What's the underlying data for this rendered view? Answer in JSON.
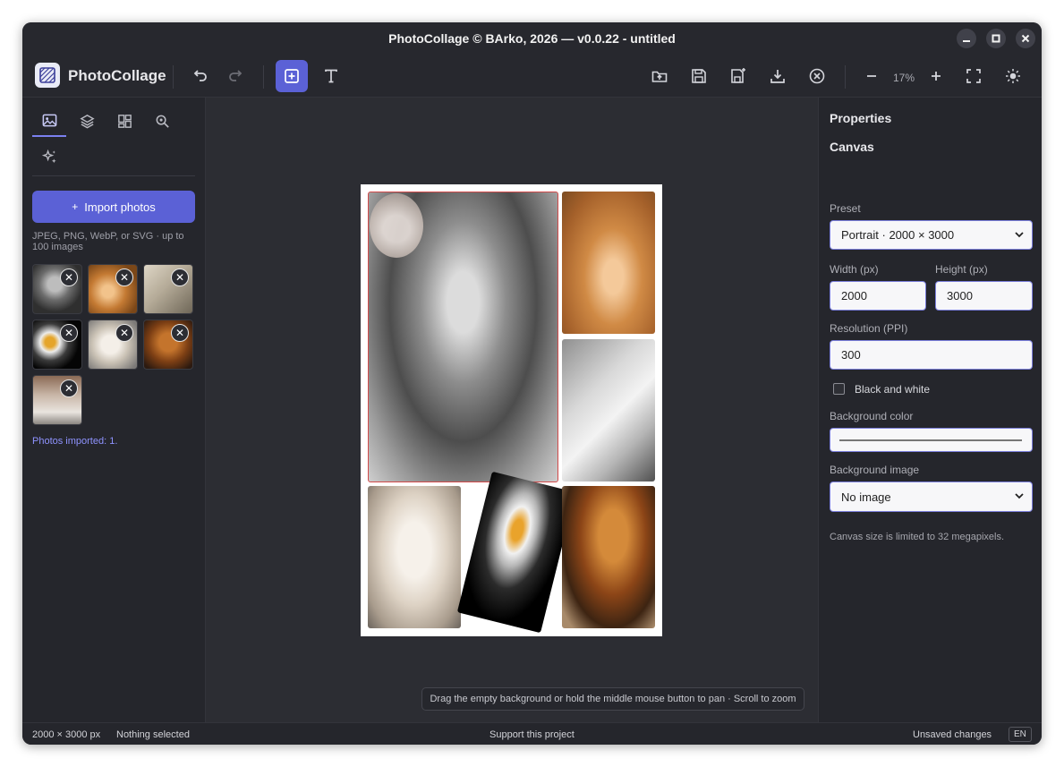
{
  "window": {
    "title": "PhotoCollage © BArko, 2026 — v0.0.22 - untitled",
    "controls": [
      "minimize-icon",
      "maximize-icon",
      "close-icon"
    ]
  },
  "toolbar": {
    "app_name": "PhotoCollage",
    "zoom": "17%",
    "icons": [
      "undo-icon",
      "redo-icon",
      "add-frame-icon",
      "text-icon",
      "open-icon",
      "save-icon",
      "save-as-icon",
      "export-icon",
      "close-project-icon",
      "zoom-out-icon",
      "zoom-in-icon",
      "fit-screen-icon",
      "theme-icon"
    ]
  },
  "left_panel": {
    "tabs": [
      "photos-tab-icon",
      "layers-tab-icon",
      "layout-tab-icon",
      "zoom-tab-icon",
      "effects-tab-icon"
    ],
    "import_label": "Import photos",
    "import_plus": "+",
    "import_hint": "JPEG, PNG, WebP, or SVG · up to 100 images",
    "remove_glyph": "✕",
    "photos": [
      "old man",
      "cat",
      "horse",
      "eagle",
      "alpaca",
      "lion",
      "bearded man"
    ],
    "status": "Photos imported: 1."
  },
  "canvas": {
    "help": "Drag the empty background or hold the middle mouse button to pan · Scroll to zoom"
  },
  "properties": {
    "heading": "Properties",
    "section": "Canvas",
    "preset_label": "Preset",
    "preset_value": "Portrait · 2000 × 3000",
    "width_label": "Width (px)",
    "width_value": "2000",
    "height_label": "Height (px)",
    "height_value": "3000",
    "resolution_label": "Resolution (PPI)",
    "resolution_value": "300",
    "bw_label": "Black and white",
    "bg_color_label": "Background color",
    "bg_image_label": "Background image",
    "bg_image_value": "No image",
    "note": "Canvas size is limited to 32 megapixels."
  },
  "status": {
    "size": "2000 × 3000 px",
    "selection": "Nothing selected",
    "support": "Support this project",
    "unsaved": "Unsaved changes",
    "lang": "EN"
  }
}
